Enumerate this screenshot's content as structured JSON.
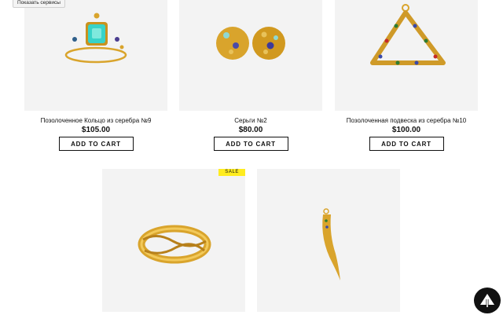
{
  "tooltip": {
    "text": "Показать сервисы"
  },
  "cart_label": "ADD TO CART",
  "products": [
    {
      "name": "Позолоченное Кольцо из серебра №9",
      "price": "$105.00",
      "image_icon": "emerald-ring-icon"
    },
    {
      "name": "Серьги №2",
      "price": "$80.00",
      "image_icon": "stud-earrings-icon"
    },
    {
      "name": "Позолоченная подвеска из серебра №10",
      "price": "$100.00",
      "image_icon": "triangle-pendant-icon"
    },
    {
      "name": "",
      "price": "",
      "image_icon": "gold-band-ring-icon",
      "badge": "SALE"
    },
    {
      "name": "",
      "price": "",
      "image_icon": "horn-pendant-icon"
    }
  ],
  "scroll_top": {
    "icon": "arrow-up-icon"
  },
  "colors": {
    "sale_badge": "#ffec1f",
    "gold": "#d9a42c",
    "image_bg": "#f3f3f3"
  }
}
